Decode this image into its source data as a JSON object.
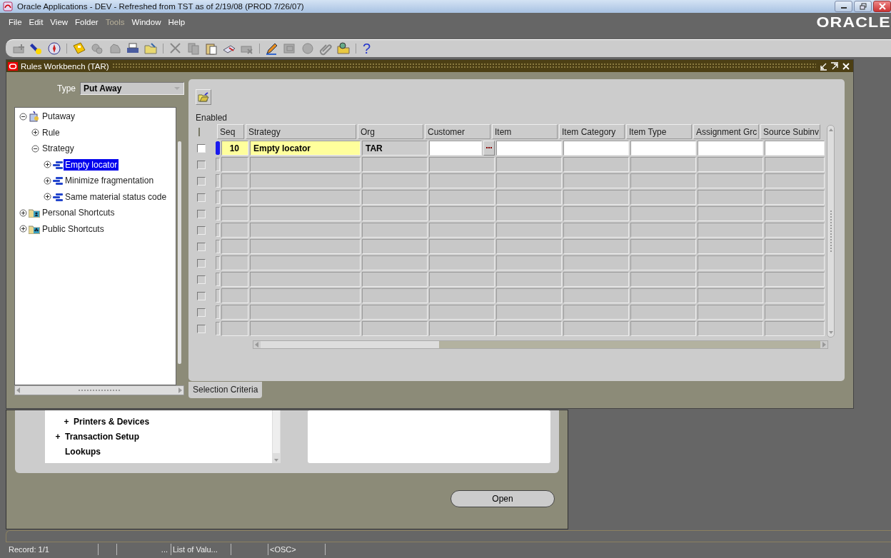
{
  "window": {
    "title": "Oracle Applications - DEV - Refreshed from TST as of 2/19/08 (PROD 7/26/07)"
  },
  "menu": [
    {
      "label": "File",
      "disabled": false
    },
    {
      "label": "Edit",
      "disabled": false
    },
    {
      "label": "View",
      "disabled": false
    },
    {
      "label": "Folder",
      "disabled": false
    },
    {
      "label": "Tools",
      "disabled": true
    },
    {
      "label": "Window",
      "disabled": false
    },
    {
      "label": "Help",
      "disabled": false
    }
  ],
  "brand": "ORACLE",
  "toolbar": [
    {
      "kind": "new",
      "disabled": true
    },
    {
      "kind": "find",
      "disabled": false
    },
    {
      "kind": "navigator",
      "disabled": false
    },
    {
      "kind": "separator"
    },
    {
      "kind": "save",
      "disabled": false
    },
    {
      "kind": "next-step",
      "disabled": true
    },
    {
      "kind": "switch",
      "disabled": true
    },
    {
      "kind": "print",
      "disabled": false
    },
    {
      "kind": "close",
      "disabled": false
    },
    {
      "kind": "separator"
    },
    {
      "kind": "cut",
      "disabled": true
    },
    {
      "kind": "copy",
      "disabled": true
    },
    {
      "kind": "paste",
      "disabled": false
    },
    {
      "kind": "clear",
      "disabled": false
    },
    {
      "kind": "delete",
      "disabled": true
    },
    {
      "kind": "separator"
    },
    {
      "kind": "edit",
      "disabled": false
    },
    {
      "kind": "translate",
      "disabled": true
    },
    {
      "kind": "zoom",
      "disabled": true
    },
    {
      "kind": "attach",
      "disabled": true
    },
    {
      "kind": "folder-tools",
      "disabled": false
    },
    {
      "kind": "separator"
    },
    {
      "kind": "help",
      "disabled": false,
      "glyph": "?"
    }
  ],
  "form": {
    "title": "Rules Workbench (TAR)",
    "type_label": "Type",
    "type_value": "Put Away",
    "tree": [
      {
        "label": "Putaway",
        "kind": "root",
        "expanded": true,
        "selected": false,
        "children": [
          {
            "label": "Rule",
            "expanded": false,
            "selected": false
          },
          {
            "label": "Strategy",
            "expanded": true,
            "selected": false,
            "children": [
              {
                "label": "Empty locator",
                "kind": "strategy",
                "expanded": false,
                "selected": true
              },
              {
                "label": "Minimize fragmentation",
                "kind": "strategy",
                "expanded": false,
                "selected": false
              },
              {
                "label": "Same material status code",
                "kind": "strategy",
                "expanded": false,
                "selected": false
              }
            ]
          }
        ]
      },
      {
        "label": "Personal Shortcuts",
        "kind": "personal-folder",
        "expanded": false,
        "selected": false
      },
      {
        "label": "Public Shortcuts",
        "kind": "public-folder",
        "expanded": false,
        "selected": false
      }
    ],
    "enabled_label": "Enabled",
    "grid": {
      "columns": [
        {
          "label": "Seq",
          "kind": "required"
        },
        {
          "label": "Strategy",
          "kind": "required"
        },
        {
          "label": "Org",
          "kind": "readonly"
        },
        {
          "label": "Customer",
          "kind": "lov"
        },
        {
          "label": "Item",
          "kind": "optional"
        },
        {
          "label": "Item Category",
          "kind": "optional"
        },
        {
          "label": "Item Type",
          "kind": "optional"
        },
        {
          "label": "Assignment Grc",
          "kind": "optional"
        },
        {
          "label": "Source Subinv",
          "kind": "optional"
        }
      ],
      "rows": [
        {
          "checked": false,
          "current": true,
          "cells": [
            "10",
            "Empty locator",
            "TAR"
          ]
        },
        {
          "checked": false,
          "current": false
        },
        {
          "checked": false,
          "current": false
        },
        {
          "checked": false,
          "current": false
        },
        {
          "checked": false,
          "current": false
        },
        {
          "checked": false,
          "current": false
        },
        {
          "checked": false,
          "current": false
        },
        {
          "checked": false,
          "current": false
        },
        {
          "checked": false,
          "current": false
        },
        {
          "checked": false,
          "current": false
        },
        {
          "checked": false,
          "current": false
        },
        {
          "checked": false,
          "current": false
        }
      ]
    },
    "tab": {
      "label": "Selection Criteria",
      "selected": true
    }
  },
  "navigator": {
    "items": [
      {
        "marker": "+",
        "label": "Printers & Devices",
        "kind": "child"
      },
      {
        "marker": "+",
        "label": "Transaction Setup",
        "kind": "top"
      },
      {
        "label": "Lookups",
        "kind": "top"
      }
    ],
    "open_button": "Open"
  },
  "status_bar": [
    {
      "text": "Record: 1/1",
      "kind": "field"
    },
    {
      "kind": "blank"
    },
    {
      "text": "...",
      "kind": "field"
    },
    {
      "text": "List of Valu...",
      "kind": "field"
    },
    {
      "kind": "blank"
    },
    {
      "text": "<OSC>",
      "kind": "field"
    }
  ]
}
